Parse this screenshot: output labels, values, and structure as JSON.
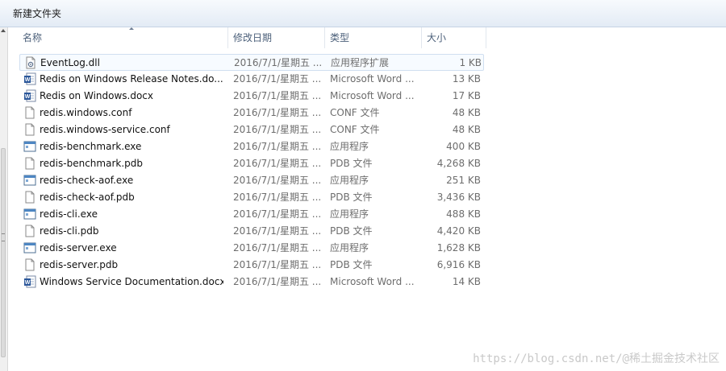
{
  "toolbar": {
    "new_folder_label": "新建文件夹"
  },
  "columns": {
    "name": "名称",
    "date": "修改日期",
    "type": "类型",
    "size": "大小"
  },
  "files": [
    {
      "name": "EventLog.dll",
      "date": "2016/7/1/星期五 ...",
      "type": "应用程序扩展",
      "size": "1 KB",
      "icon": "dll-file-icon",
      "selected": true
    },
    {
      "name": "Redis on Windows Release Notes.do...",
      "date": "2016/7/1/星期五 ...",
      "type": "Microsoft Word ...",
      "size": "13 KB",
      "icon": "word-document-icon"
    },
    {
      "name": "Redis on Windows.docx",
      "date": "2016/7/1/星期五 ...",
      "type": "Microsoft Word ...",
      "size": "17 KB",
      "icon": "word-document-icon"
    },
    {
      "name": "redis.windows.conf",
      "date": "2016/7/1/星期五 ...",
      "type": "CONF 文件",
      "size": "48 KB",
      "icon": "blank-file-icon"
    },
    {
      "name": "redis.windows-service.conf",
      "date": "2016/7/1/星期五 ...",
      "type": "CONF 文件",
      "size": "48 KB",
      "icon": "blank-file-icon"
    },
    {
      "name": "redis-benchmark.exe",
      "date": "2016/7/1/星期五 ...",
      "type": "应用程序",
      "size": "400 KB",
      "icon": "application-icon"
    },
    {
      "name": "redis-benchmark.pdb",
      "date": "2016/7/1/星期五 ...",
      "type": "PDB 文件",
      "size": "4,268 KB",
      "icon": "blank-file-icon"
    },
    {
      "name": "redis-check-aof.exe",
      "date": "2016/7/1/星期五 ...",
      "type": "应用程序",
      "size": "251 KB",
      "icon": "application-icon"
    },
    {
      "name": "redis-check-aof.pdb",
      "date": "2016/7/1/星期五 ...",
      "type": "PDB 文件",
      "size": "3,436 KB",
      "icon": "blank-file-icon"
    },
    {
      "name": "redis-cli.exe",
      "date": "2016/7/1/星期五 ...",
      "type": "应用程序",
      "size": "488 KB",
      "icon": "application-icon"
    },
    {
      "name": "redis-cli.pdb",
      "date": "2016/7/1/星期五 ...",
      "type": "PDB 文件",
      "size": "4,420 KB",
      "icon": "blank-file-icon"
    },
    {
      "name": "redis-server.exe",
      "date": "2016/7/1/星期五 ...",
      "type": "应用程序",
      "size": "1,628 KB",
      "icon": "application-icon"
    },
    {
      "name": "redis-server.pdb",
      "date": "2016/7/1/星期五 ...",
      "type": "PDB 文件",
      "size": "6,916 KB",
      "icon": "blank-file-icon"
    },
    {
      "name": "Windows Service Documentation.docx",
      "date": "2016/7/1/星期五 ...",
      "type": "Microsoft Word ...",
      "size": "14 KB",
      "icon": "word-document-icon"
    }
  ],
  "watermark": "https://blog.csdn.net/@稀土掘金技术社区"
}
